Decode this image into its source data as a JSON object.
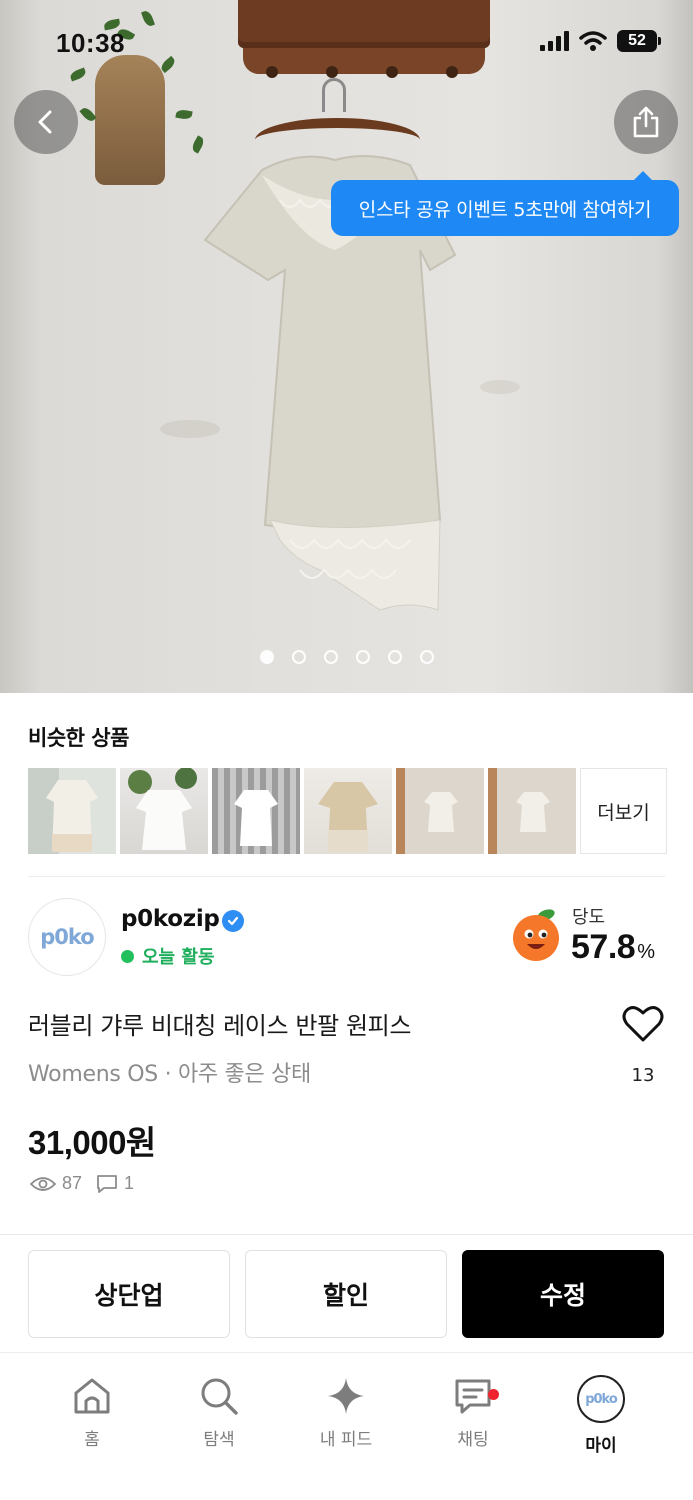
{
  "status_bar": {
    "time": "10:38",
    "battery": "52"
  },
  "hero": {
    "share_tooltip": "인스타 공유 이벤트 5초만에 참여하기",
    "page_count": 6,
    "active_page": 1
  },
  "similar": {
    "title": "비슷한 상품",
    "more_label": "더보기",
    "thumbnail_count": 6
  },
  "seller": {
    "name": "p0kozip",
    "avatar_text": "p0ko",
    "activity": "오늘 활동",
    "sweetness_label": "당도",
    "sweetness_value": "57.8",
    "sweetness_unit": "%"
  },
  "product": {
    "title": "러블리 갸루 비대칭 레이스 반팔 원피스",
    "subtitle": "Womens OS · 아주 좋은 상태",
    "price": "31,000원",
    "likes": "13",
    "views": "87",
    "chats": "1"
  },
  "actions": {
    "bump": "상단업",
    "discount": "할인",
    "edit": "수정"
  },
  "nav": {
    "home": "홈",
    "search": "탐색",
    "feed": "내 피드",
    "chat": "채팅",
    "my": "마이"
  },
  "colors": {
    "accent_blue": "#1e88f5",
    "active_green": "#21c05d",
    "notify_red": "#f0242f",
    "primary": "#000000"
  }
}
